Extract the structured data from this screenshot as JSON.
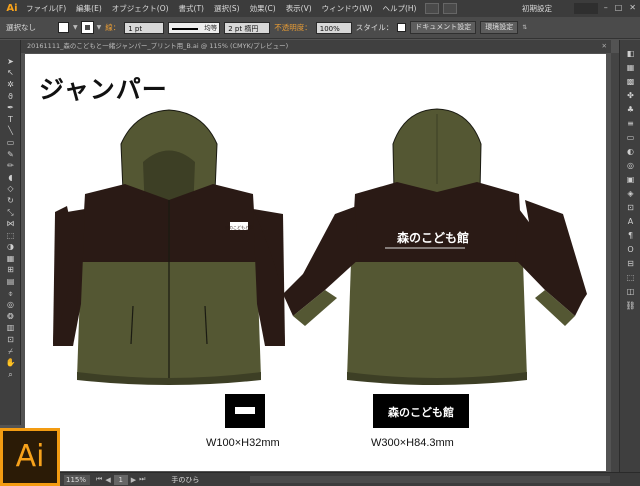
{
  "app": {
    "logo": "Ai",
    "workspace": "初期設定",
    "window_controls": [
      "–",
      "□",
      "✕"
    ]
  },
  "menu": [
    "ファイル(F)",
    "編集(E)",
    "オブジェクト(O)",
    "書式(T)",
    "選択(S)",
    "効果(C)",
    "表示(V)",
    "ウィンドウ(W)",
    "ヘルプ(H)"
  ],
  "control": {
    "selection": "選択なし",
    "stroke_label": "線：",
    "stroke_weight": "1 pt",
    "stroke_profile": "均等",
    "brush": "2 pt 楕円",
    "opacity_label": "不透明度：",
    "opacity": "100%",
    "style_label": "スタイル：",
    "doc_settings": "ドキュメント設定",
    "preferences": "環境設定"
  },
  "document_tab": "20161111_森のこどもと一緒ジャンパー_プリント用_B.ai @ 115% (CMYK/プレビュー)",
  "artboard": {
    "title": "ジャンパー",
    "front_logo_text": "森のこどもと館",
    "back_logo_text": "森のこども館",
    "front_size_label": "W100×H32mm",
    "back_size_label": "W300×H84.3mm"
  },
  "colors": {
    "olive": "#545733",
    "brown": "#2a1a15",
    "accent": "#f39c12"
  },
  "status": {
    "zoom": "115%",
    "page": "1",
    "tool": "手のひら"
  },
  "big_logo": "Ai"
}
